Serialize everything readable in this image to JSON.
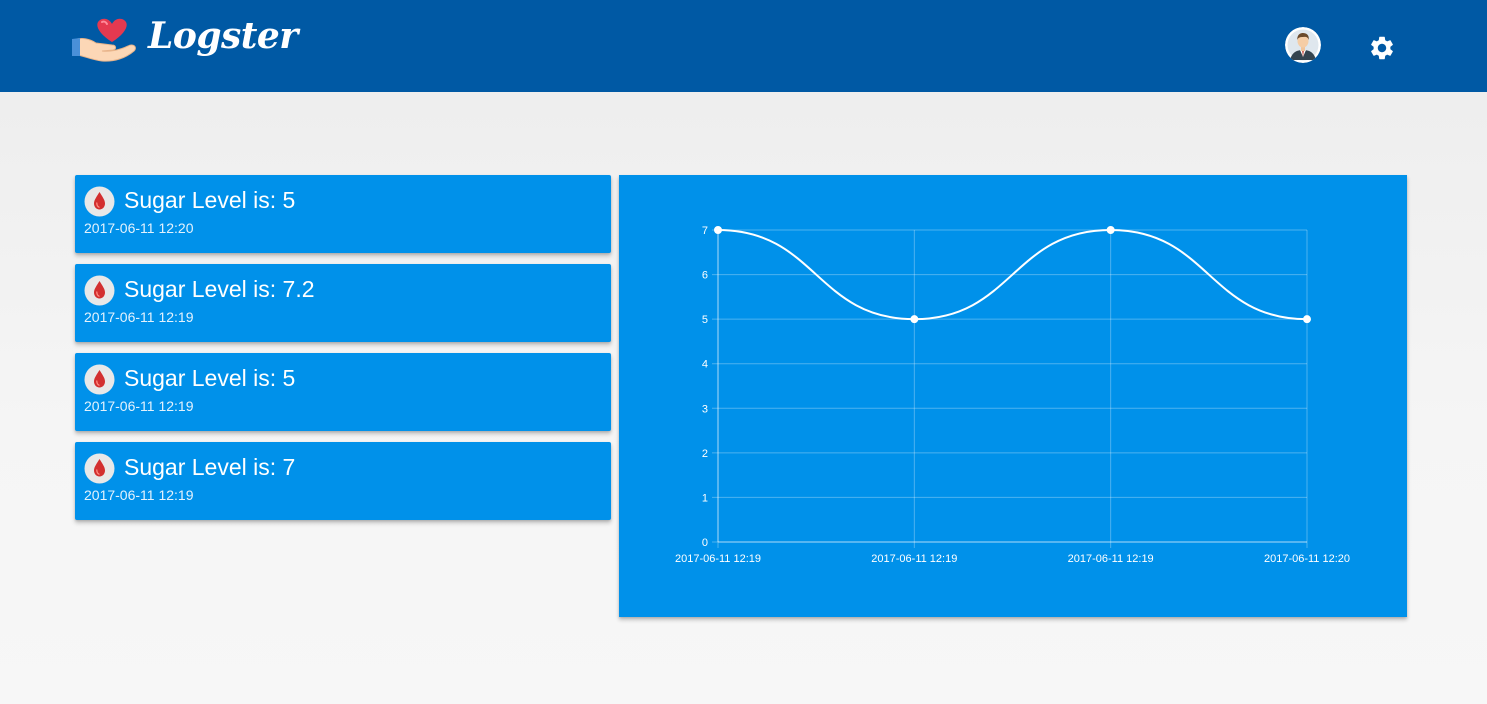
{
  "app": {
    "name": "Logster"
  },
  "header": {
    "logo_icon": "heart-in-hand-icon",
    "avatar_icon": "user-avatar-icon",
    "settings_icon": "gear-icon"
  },
  "readings": [
    {
      "label": "Sugar Level is: 5",
      "time": "2017-06-11 12:20"
    },
    {
      "label": "Sugar Level is: 7.2",
      "time": "2017-06-11 12:19"
    },
    {
      "label": "Sugar Level is: 5",
      "time": "2017-06-11 12:19"
    },
    {
      "label": "Sugar Level is: 7",
      "time": "2017-06-11 12:19"
    }
  ],
  "colors": {
    "header": "#0059a4",
    "card": "#0091ea",
    "drop": "#d32f2f"
  },
  "chart_data": {
    "type": "line",
    "x": [
      "2017-06-11 12:19",
      "2017-06-11 12:19",
      "2017-06-11 12:19",
      "2017-06-11 12:20"
    ],
    "series": [
      {
        "values": [
          7,
          5,
          7,
          5
        ]
      }
    ],
    "ylim": [
      0,
      7
    ],
    "yticks": [
      0,
      1,
      2,
      3,
      4,
      5,
      6,
      7
    ],
    "grid": true,
    "smooth": true,
    "line_color": "#ffffff"
  }
}
